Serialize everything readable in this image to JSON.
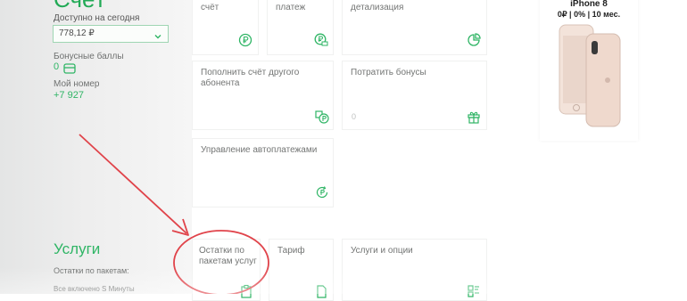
{
  "header": {
    "title": "Счёт"
  },
  "balance": {
    "label": "Доступно на сегодня",
    "value": "778,12 ₽"
  },
  "bonus": {
    "label": "Бонусные баллы",
    "value": "0"
  },
  "number": {
    "label": "Мой номер",
    "value": "+7 927"
  },
  "tiles": {
    "topup": {
      "label": "счёт"
    },
    "payment": {
      "label": "платеж"
    },
    "details": {
      "label": "детализация"
    },
    "topup_other": {
      "label": "Пополнить счёт другого абонента"
    },
    "spend_bonus": {
      "label": "Потратить бонусы",
      "value": "0"
    },
    "autopay": {
      "label": "Управление автоплатежами"
    },
    "package_remains": {
      "label": "Остатки по пакетам услуг"
    },
    "tariff": {
      "label": "Тариф"
    },
    "services_options": {
      "label": "Услуги и опции"
    }
  },
  "services_section": {
    "title": "Услуги",
    "remains_label": "Остатки по пакетам:",
    "included": "Все включено S Минуты"
  },
  "ad": {
    "brand": "iPhone 8",
    "offer": "0₽ | 0% | 10 мес."
  },
  "colors": {
    "accent": "#2fb565",
    "annotation": "#e0434a"
  }
}
